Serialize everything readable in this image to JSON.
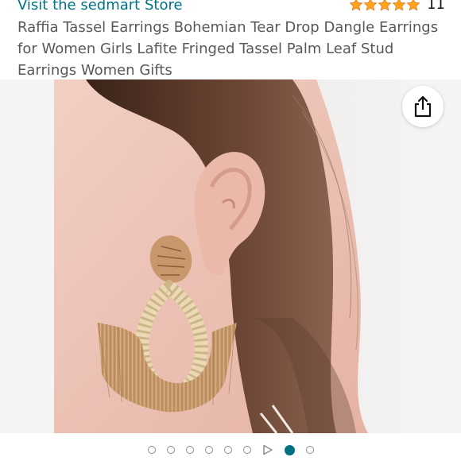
{
  "header": {
    "store_link": "Visit the sedmart Store",
    "rating_stars": 5,
    "rating_count": "11",
    "star_color": "#ffa41c"
  },
  "product": {
    "title": "Raffia Tassel Earrings Bohemian Tear Drop Dangle Earrings for Women Girls Lafite Fringed Tassel Palm Leaf Stud Earrings Women Gifts"
  },
  "gallery": {
    "share_icon": "share-icon",
    "dot_count": 9,
    "video_dot_index": 6,
    "active_index": 7,
    "accent": "#007185"
  }
}
